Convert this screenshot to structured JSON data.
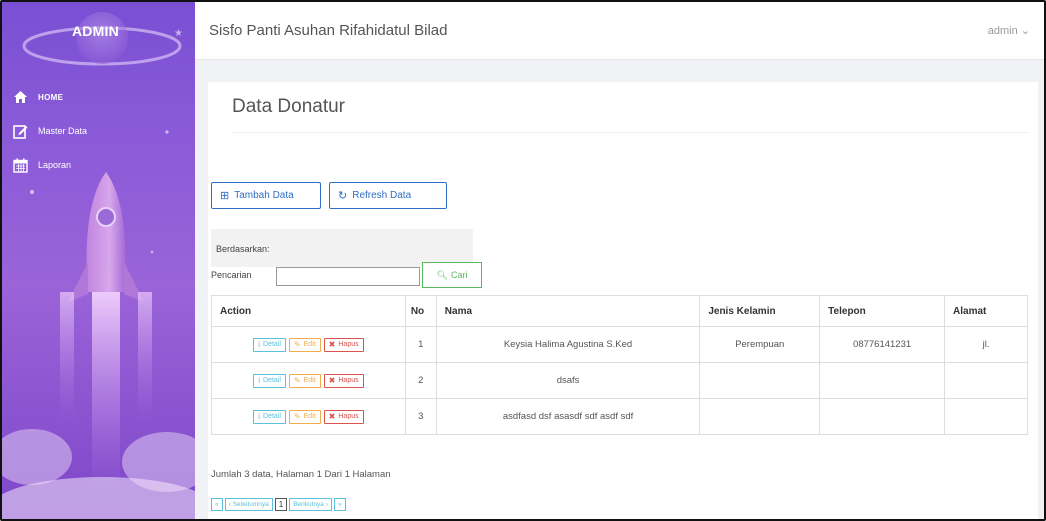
{
  "sidebar": {
    "brand": "ADMIN",
    "pin": "★",
    "items": [
      {
        "label": "HOME",
        "icon": "home-icon"
      },
      {
        "label": "Master Data",
        "icon": "edit-icon"
      },
      {
        "label": "Laporan",
        "icon": "calendar-icon"
      }
    ]
  },
  "topbar": {
    "title": "Sisfo Panti Asuhan Rifahidatul Bilad",
    "user": "admin ⌄"
  },
  "panel": {
    "title": "Data Donatur",
    "btn_tambah": "Tambah Data",
    "btn_refresh": "Refresh Data",
    "lbl_berdasarkan": "Berdasarkan:",
    "lbl_pencarian": "Pencarian",
    "search_value": "",
    "btn_cari": "Cari"
  },
  "table": {
    "headers": [
      "Action",
      "No",
      "Nama",
      "Jenis Kelamin",
      "Telepon",
      "Alamat"
    ],
    "action_labels": {
      "detail": "Detail",
      "edit": "Edit",
      "hapus": "Hapus"
    },
    "rows": [
      {
        "no": "1",
        "nama": "Keysia Halima Agustina S.Ked",
        "jk": "Perempuan",
        "telepon": "08776141231",
        "alamat": "jl."
      },
      {
        "no": "2",
        "nama": "dsafs",
        "jk": "",
        "telepon": "",
        "alamat": ""
      },
      {
        "no": "3",
        "nama": "asdfasd dsf asasdf sdf asdf sdf",
        "jk": "",
        "telepon": "",
        "alamat": ""
      }
    ]
  },
  "summary": "Jumlah 3 data, Halaman 1 Dari 1 Halaman",
  "pager": {
    "first": "«",
    "prev": "‹ Sebelumnya",
    "current": "1",
    "next": "Berikutnya ›",
    "last": "»"
  },
  "colors": {
    "sidebar_top": "#7a4fd3",
    "sidebar_bottom": "#7f47c9",
    "primary": "#2f6ec4",
    "success": "#5cb85c",
    "info": "#5bc0de",
    "warning": "#f0ad4e",
    "danger": "#d9534f"
  }
}
